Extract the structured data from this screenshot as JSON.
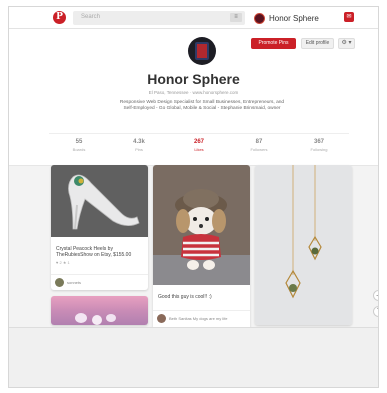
{
  "topbar": {
    "logo": "P",
    "search_placeholder": "Search",
    "search_menu_icon": "menu-icon",
    "user_name": "Honor Sphere",
    "notification_icon": "notification-icon"
  },
  "profile": {
    "promote_label": "Promote Pins",
    "edit_label": "Edit profile",
    "settings_label": "⚙ ▾",
    "name": "Honor Sphere",
    "location": "El Paso, Tennessee · www.honorsphere.com",
    "bio": "Responsive Web Design Specialist for Small Businesses, Entrepreneurs, and Self-Employed - Go Global, Mobile & Social - Stephanie Brinsmaid, owner",
    "stats": [
      {
        "num": "55",
        "label": "Boards"
      },
      {
        "num": "4.3k",
        "label": "Pins"
      },
      {
        "num": "267",
        "label": "Likes"
      },
      {
        "num": "87",
        "label": "Followers"
      },
      {
        "num": "367",
        "label": "Following"
      }
    ]
  },
  "pins": [
    {
      "desc": "Crystal Peacock Heels by TheRubiesShow on Etsy, $155.00",
      "meta": "♥ 2   ★ 1",
      "footer": "sonnets"
    },
    {
      "desc": "Good this guy is cool!! :)",
      "meta": "",
      "footer": "Beth Sanitas\nMy dogs are my life"
    },
    {
      "desc": "",
      "meta": "",
      "footer": ""
    }
  ],
  "accent": "#cb2027"
}
